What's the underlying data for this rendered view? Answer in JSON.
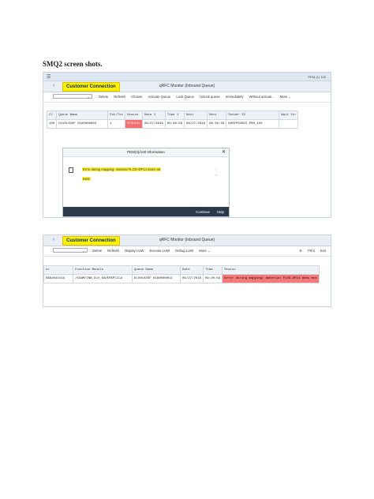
{
  "document": {
    "heading": "SMQ2 screen shots."
  },
  "shot1": {
    "system_info": "PEM (1) 100",
    "customer_label": "Customer Connection",
    "window_title": "qRFC Monitor (Inbound Queue)",
    "toolbar": [
      "Delete",
      "Refresh",
      "Choose",
      "Activate Queue",
      "Lock Queue",
      "Unlock queue",
      "Immediately",
      "Without activati...",
      "More ⌄"
    ],
    "columns": [
      "Cl.",
      "Queue Name",
      "Ent/Tes",
      "Status",
      "Date 1",
      "Time 1",
      "Next",
      "Next",
      "Sender ID",
      "Wait for"
    ],
    "row": [
      "100",
      "DLV0L0ZKF  0180000053",
      "1",
      "SYSFAIL",
      "06/27/2019",
      "09:30:59",
      "06/27/2019",
      "09:30:59",
      "VHSFPGUBOI_PEM_100",
      ""
    ],
    "dialog": {
      "title": "PEM(3)/100 Information",
      "message_line1": "Error during mapping: material FLOG-DP14 does not",
      "message_line2": "exist",
      "continue": "Continue",
      "help": "Help"
    }
  },
  "shot2": {
    "customer_label": "Customer Connection",
    "window_title": "qRFC Monitor (Inbound Queue)",
    "toolbar": [
      "Delete",
      "Refresh",
      "Display LUW",
      "Execute LUW",
      "Debug LUW",
      "More ⌄"
    ],
    "toolbar_right": [
      "Print",
      "Exit"
    ],
    "columns": [
      "er",
      "Function Module",
      "Queue Name",
      "Date",
      "Time",
      "Status"
    ],
    "row": [
      "5B8204441A",
      "/SCWM/INB_DLV_SAVEREPLICA",
      "DLV0L0ZKF   0180000053",
      "06/27/2019",
      "09:20:59",
      "Error during mapping: material FLOG-DP14 does not"
    ]
  }
}
